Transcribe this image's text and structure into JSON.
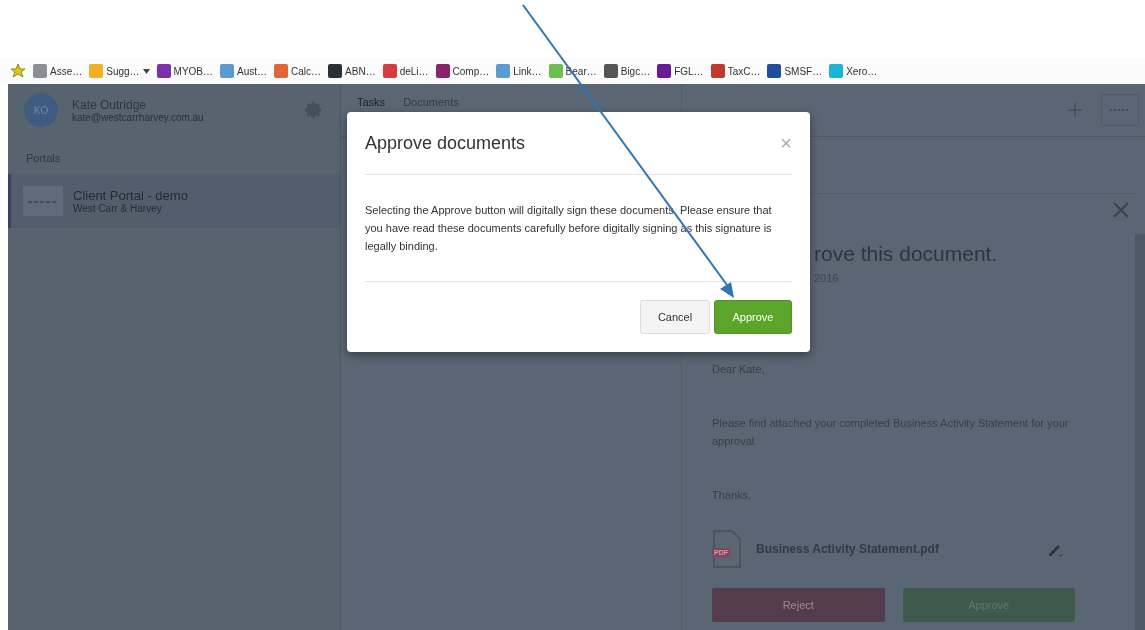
{
  "bookmarks": [
    {
      "label": "Asse…",
      "color": "#8a8f96"
    },
    {
      "label": "Sugg…",
      "color": "#f2b01e",
      "dropdown": true
    },
    {
      "label": "MYOB…",
      "color": "#7b2fa8"
    },
    {
      "label": "Aust…",
      "color": "#5b9bd5"
    },
    {
      "label": "Calc…",
      "color": "#e0663a"
    },
    {
      "label": "ABN…",
      "color": "#2a3035"
    },
    {
      "label": "deLi…",
      "color": "#d83b3b"
    },
    {
      "label": "Comp…",
      "color": "#8a2468"
    },
    {
      "label": "Link…",
      "color": "#5b9bd5"
    },
    {
      "label": "Bear…",
      "color": "#6cc04a"
    },
    {
      "label": "Bigc…",
      "color": "#555555"
    },
    {
      "label": "FGL…",
      "color": "#6a1b9a"
    },
    {
      "label": "TaxC…",
      "color": "#c0392b"
    },
    {
      "label": "SMSF…",
      "color": "#1f4e9c"
    },
    {
      "label": "Xero…",
      "color": "#1ab4d7"
    }
  ],
  "user": {
    "initials": "KO",
    "name": "Kate Outridge",
    "email": "kate@westcarrharvey.com.au"
  },
  "portals_heading": "Portals",
  "portals": [
    {
      "name": "Client Portal - demo",
      "subtitle": "West Carr & Harvey",
      "selected": true
    }
  ],
  "tabs": [
    {
      "label": "Tasks",
      "selected": true
    },
    {
      "label": "Documents",
      "selected": false
    }
  ],
  "document": {
    "heading": "rove this document.",
    "date": "2016",
    "paragraphs": [
      "Dear Kate,",
      "Please find attached your completed Business Activity Statement for your approval.",
      "Thanks,"
    ],
    "attachment": "Business Activity Statement.pdf",
    "file_badge": "PDF",
    "buttons": [
      {
        "label": "Reject",
        "kind": "reject"
      },
      {
        "label": "Approve",
        "kind": "approve"
      }
    ]
  },
  "dialog": {
    "title": "Approve documents",
    "close": "×",
    "message": "Selecting the Approve button will digitally sign these documents. Please ensure that you have read these documents carefully before digitally signing as this signature is legally binding.",
    "buttons": [
      {
        "label": "Cancel",
        "kind": "default"
      },
      {
        "label": "Approve",
        "kind": "primary"
      }
    ]
  }
}
